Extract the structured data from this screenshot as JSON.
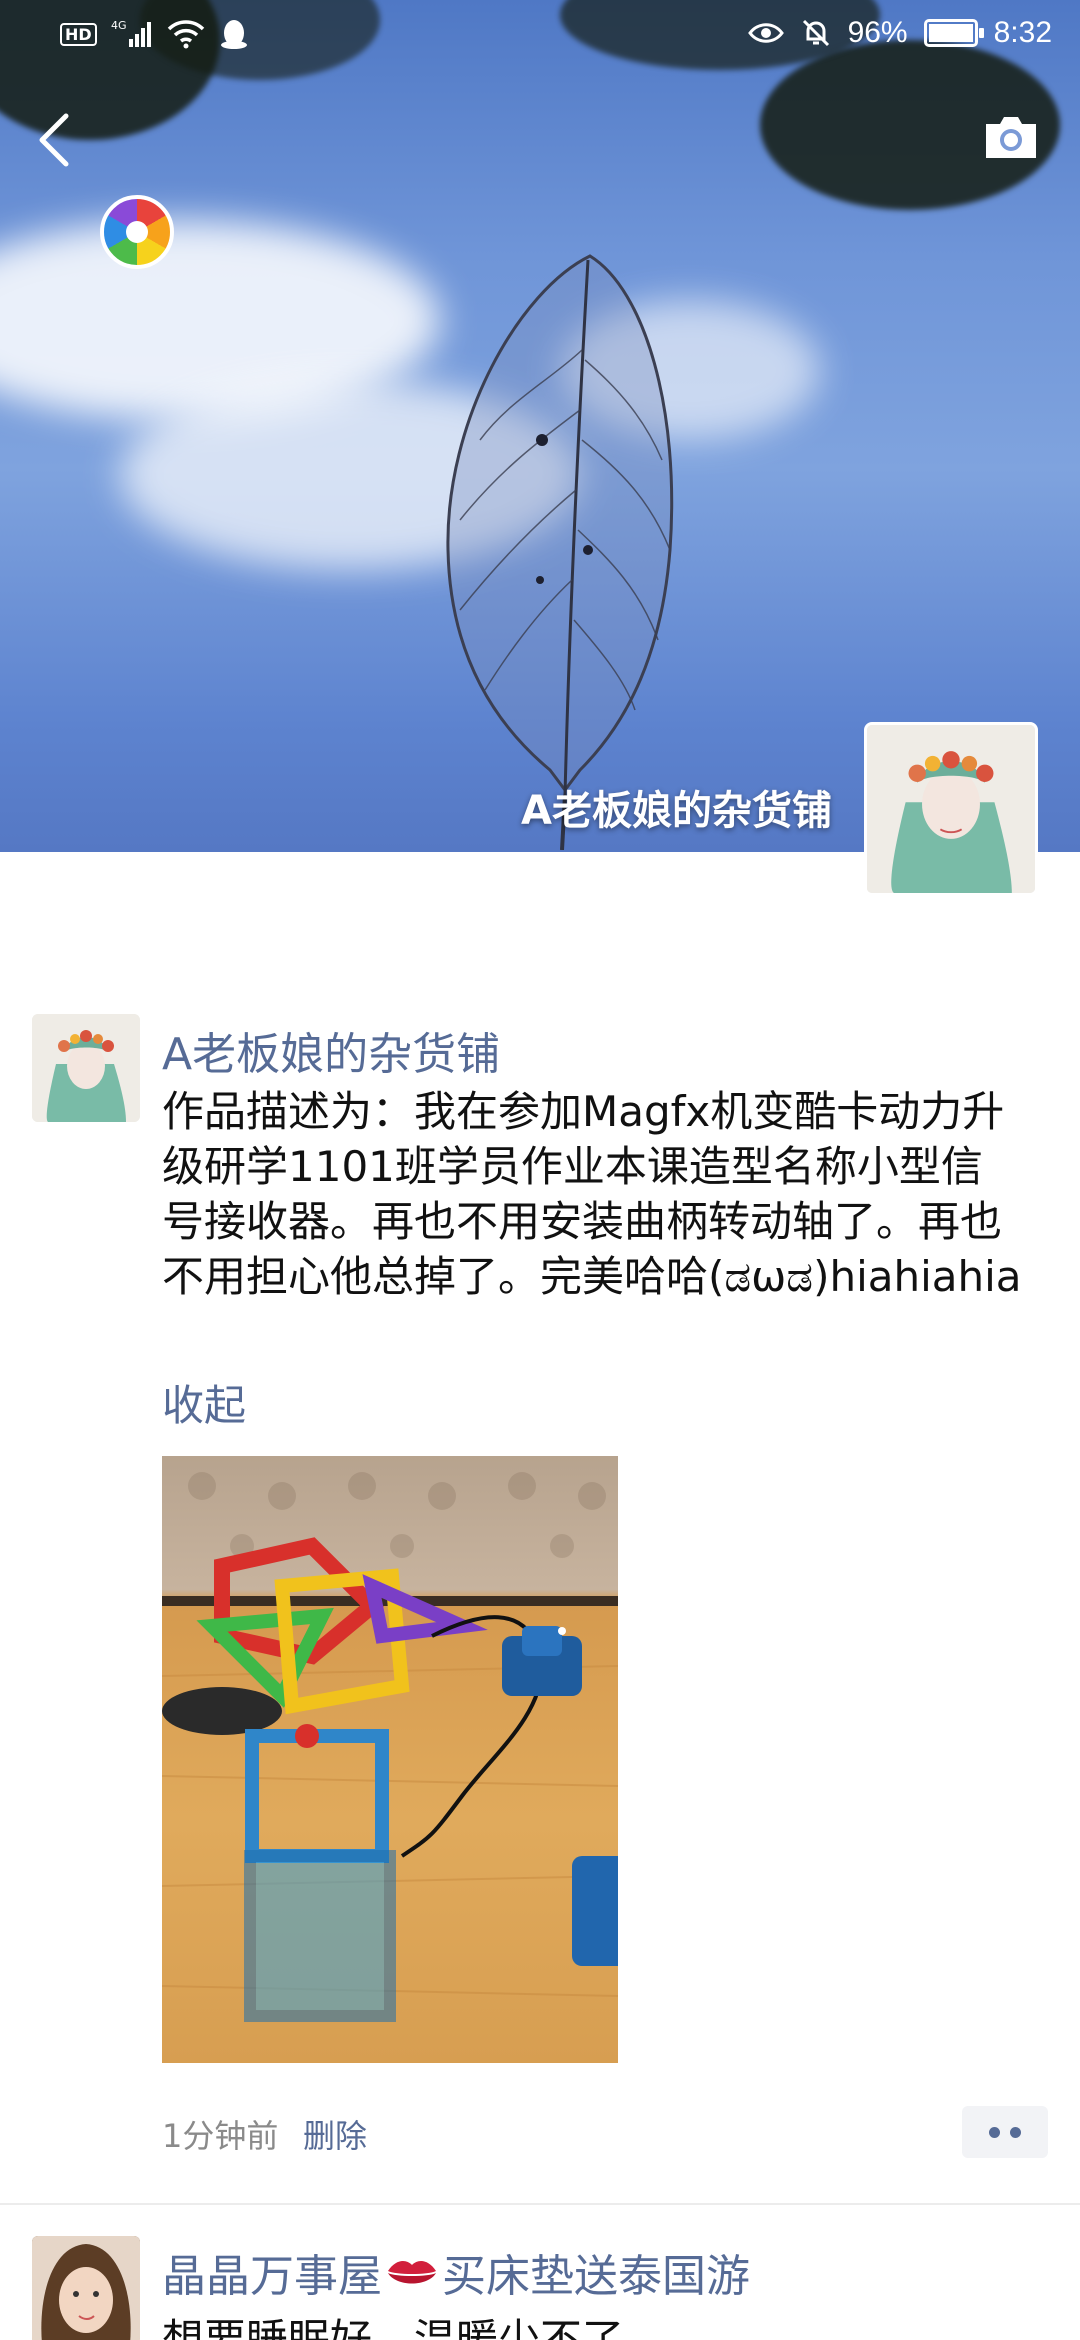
{
  "status_bar": {
    "hd_label": "HD",
    "network_label": "4G",
    "battery_text": "96%",
    "battery_level": 0.96,
    "time": "8:32"
  },
  "header": {
    "back_icon": "chevron-left-icon",
    "camera_icon": "camera-icon",
    "cover_user_name": "A老板娘的杂货铺"
  },
  "post": {
    "author": "A老板娘的杂货铺",
    "text": "作品描述为：我在参加Magfx机变酷卡动力升级研学1101班学员作业本课造型名称小型信号接收器。再也不用安装曲柄转动轴了。再也不用担心他总掉了。完美哈哈(ಡωಡ)hiahiahia",
    "collapse_label": "收起",
    "time_ago": "1分钟前",
    "delete_label": "删除"
  },
  "next_post": {
    "author_part1": "晶晶万事屋",
    "author_part2": "买床垫送泰国游",
    "text": "想要睡眠好，温暖少不了"
  },
  "colors": {
    "link_blue": "#566b96",
    "meta_gray": "#8a8a8a"
  }
}
